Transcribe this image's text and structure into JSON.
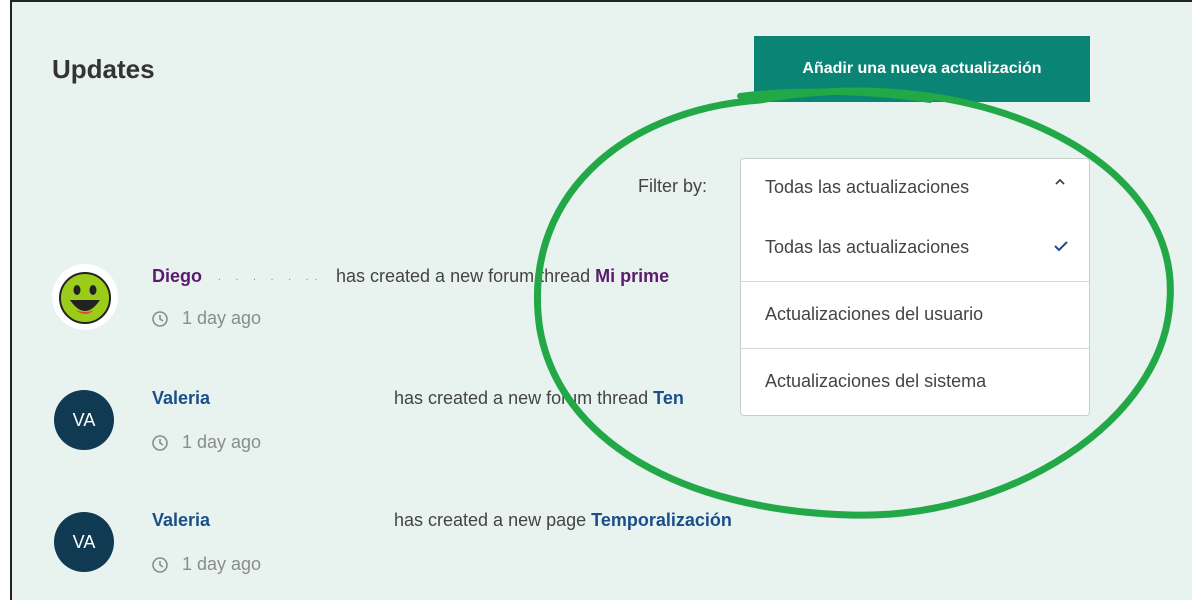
{
  "header": {
    "title": "Updates",
    "add_button_label": "Añadir una nueva actualización"
  },
  "filter": {
    "label": "Filter by:",
    "selected": "Todas las actualizaciones",
    "options": [
      {
        "label": "Todas las actualizaciones",
        "checked": true
      },
      {
        "label": "Actualizaciones del usuario",
        "checked": false
      },
      {
        "label": "Actualizaciones del sistema",
        "checked": false
      }
    ]
  },
  "updates": [
    {
      "user": "Diego",
      "avatar": "smiley-face",
      "action": "has created a new forum thread",
      "target": "Mi prime",
      "time": "1 day ago"
    },
    {
      "user": "Valeria",
      "avatar_initials": "VA",
      "action": "has created a new forum thread",
      "target": "Ten",
      "time": "1 day ago"
    },
    {
      "user": "Valeria",
      "avatar_initials": "VA",
      "action": "has created a new page",
      "target": "Temporalización",
      "time": "1 day ago"
    }
  ],
  "colors": {
    "accent": "#0a8474",
    "background": "#e8f2ef",
    "highlight_ellipse": "#22a846",
    "avatar_bg": "#0f3a52",
    "link_purple": "#5a1b6e",
    "link_blue": "#1a4f8b"
  }
}
